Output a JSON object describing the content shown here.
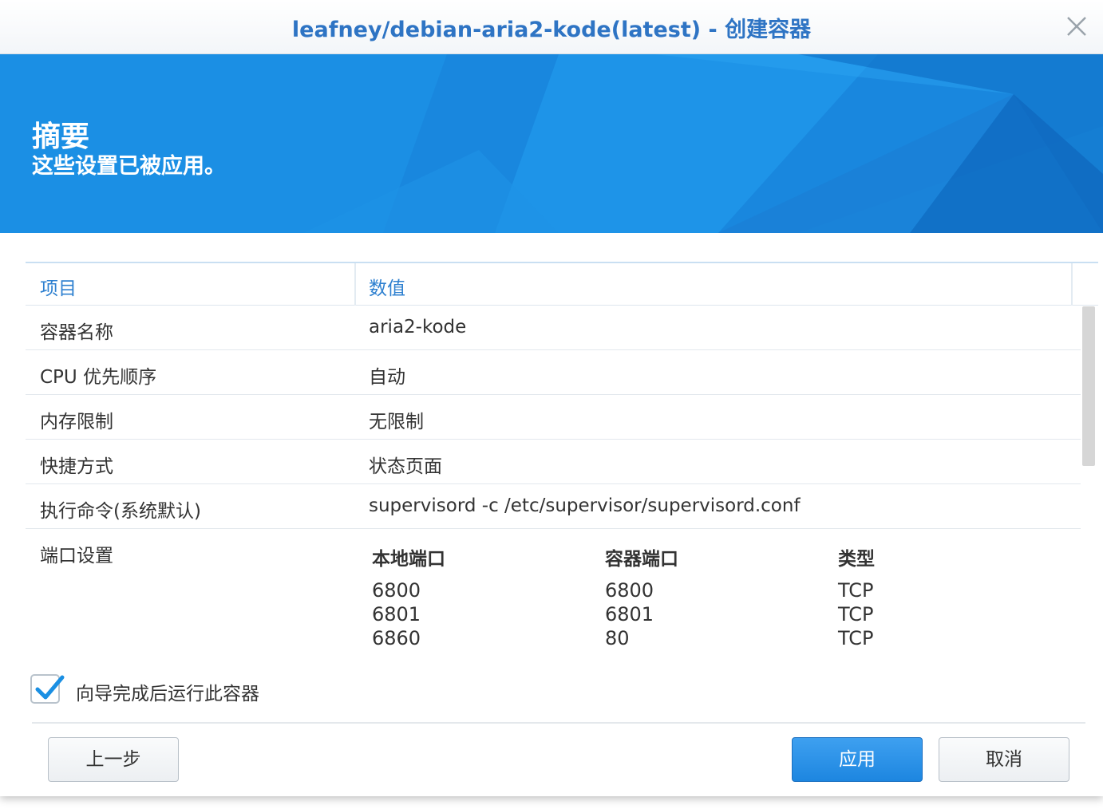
{
  "window": {
    "title": "leafney/debian-aria2-kode(latest) - 创建容器"
  },
  "banner": {
    "title": "摘要",
    "subtitle": "这些设置已被应用。"
  },
  "table": {
    "headers": {
      "item": "项目",
      "value": "数值"
    },
    "rows": [
      {
        "key": "容器名称",
        "value": "aria2-kode"
      },
      {
        "key": "CPU 优先顺序",
        "value": "自动"
      },
      {
        "key": "内存限制",
        "value": "无限制"
      },
      {
        "key": "快捷方式",
        "value": "状态页面"
      },
      {
        "key": "执行命令(系统默认)",
        "value": "supervisord -c /etc/supervisor/supervisord.conf"
      }
    ],
    "ports": {
      "key": "端口设置",
      "headers": {
        "local": "本地端口",
        "container": "容器端口",
        "type": "类型"
      },
      "rows": [
        {
          "local": "6800",
          "container": "6800",
          "type": "TCP"
        },
        {
          "local": "6801",
          "container": "6801",
          "type": "TCP"
        },
        {
          "local": "6860",
          "container": "80",
          "type": "TCP"
        }
      ]
    }
  },
  "run_after_wizard": {
    "label": "向导完成后运行此容器",
    "checked": true
  },
  "buttons": {
    "back": "上一步",
    "apply": "应用",
    "cancel": "取消"
  },
  "colors": {
    "accent": "#1a8fe3",
    "title": "#2e74c4",
    "header_text": "#2e80d0"
  },
  "icons": {
    "close": "close-icon",
    "check": "checkmark-icon"
  }
}
